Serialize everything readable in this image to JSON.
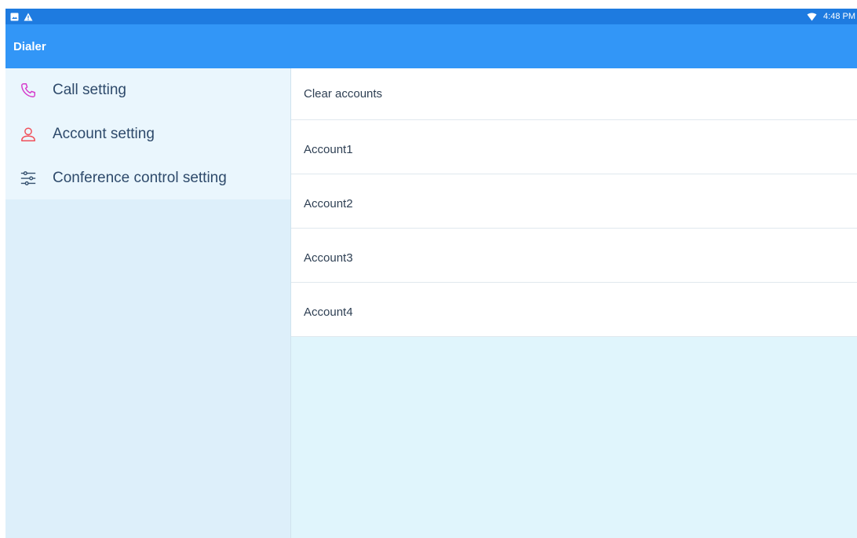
{
  "status_bar": {
    "time": "4:48 PM",
    "icons": [
      "image-icon",
      "warning-icon",
      "wifi-icon"
    ]
  },
  "app_bar": {
    "title": "Dialer"
  },
  "sidebar": {
    "items": [
      {
        "label": "Call setting",
        "icon": "phone-icon",
        "icon_color": "#D63CCB"
      },
      {
        "label": "Account setting",
        "icon": "person-icon",
        "icon_color": "#F0505A"
      },
      {
        "label": "Conference control setting",
        "icon": "sliders-icon",
        "icon_color": "#34506E"
      }
    ]
  },
  "main": {
    "items": [
      {
        "label": "Clear accounts"
      },
      {
        "label": "Account1"
      },
      {
        "label": "Account2"
      },
      {
        "label": "Account3"
      },
      {
        "label": "Account4"
      }
    ]
  },
  "colors": {
    "status_bar": "#1E7BE0",
    "app_bar": "#3296F7",
    "sidebar_bg": "#EAF6FD",
    "sidebar_fill": "#DDEFFA",
    "main_bg": "#E0F5FC"
  }
}
